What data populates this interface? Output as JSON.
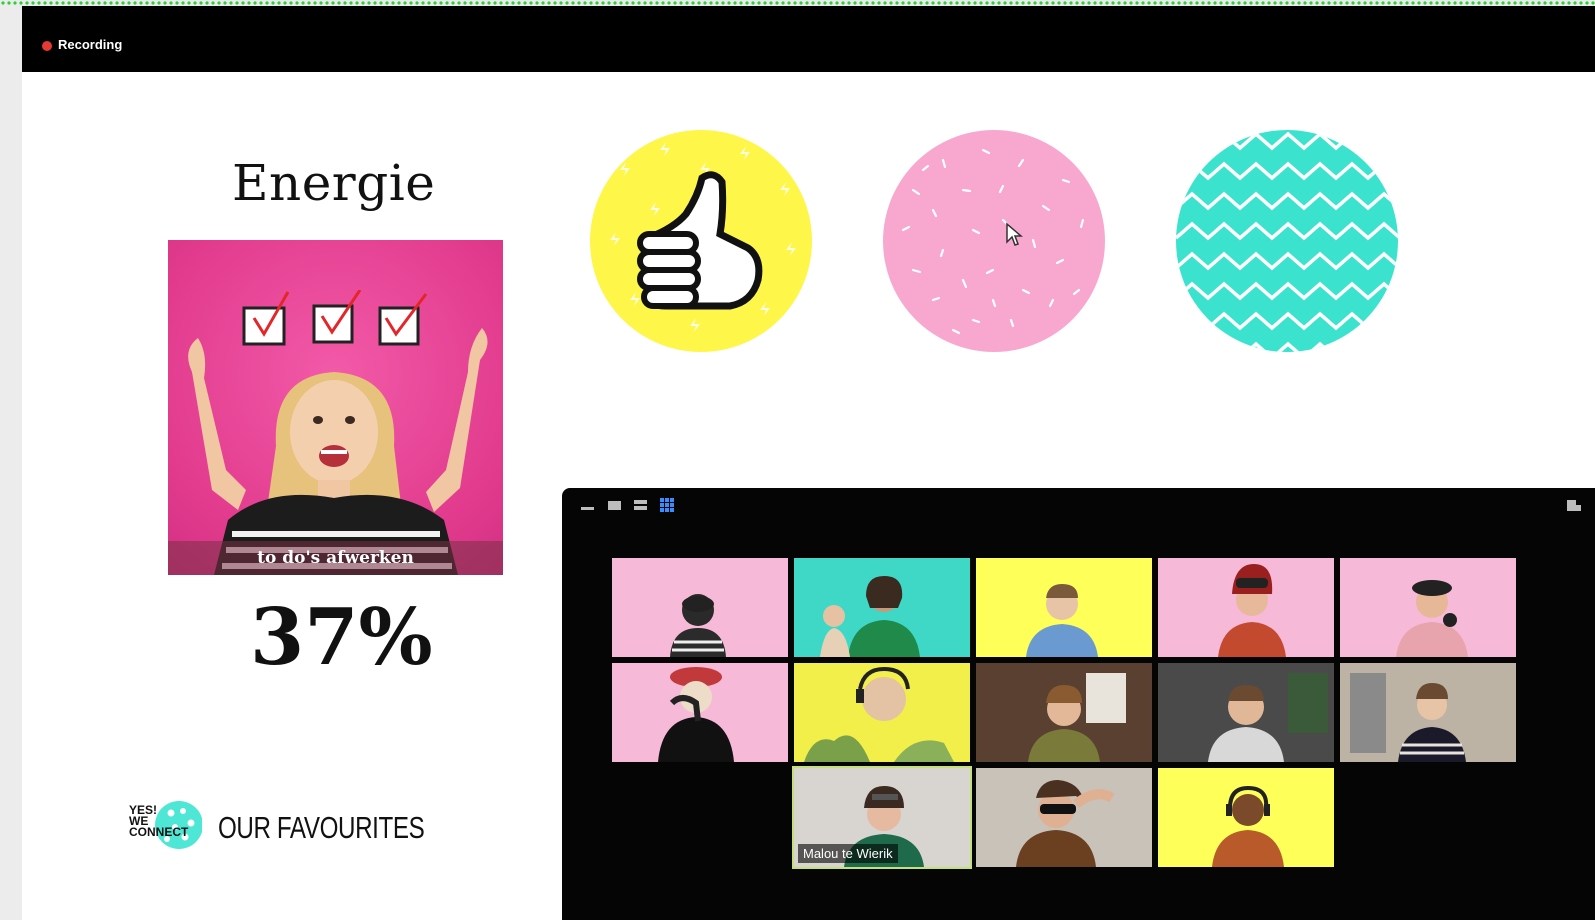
{
  "recording": {
    "label": "Recording",
    "dot_color": "#e53935"
  },
  "slide": {
    "title": "Energie",
    "photo_caption": "to do's afwerken",
    "percent": "37%",
    "options": [
      {
        "color": "#fff64a",
        "icon": "thumbs-up-icon"
      },
      {
        "color": "#f8a8cf",
        "pattern": "sprinkles"
      },
      {
        "color": "#3be3cf",
        "pattern": "zigzag"
      }
    ],
    "logo_lines": [
      "YES!",
      "WE",
      "CONNECT"
    ],
    "brand": "OUR FAVOURITES"
  },
  "zoom": {
    "toolbar": [
      "minimize-icon",
      "speaker-view-icon",
      "sidebar-view-icon",
      "gallery-view-icon",
      "fullscreen-icon"
    ],
    "active_speaker_name": "Malou te Wierik",
    "accent": "#c4e07a"
  }
}
